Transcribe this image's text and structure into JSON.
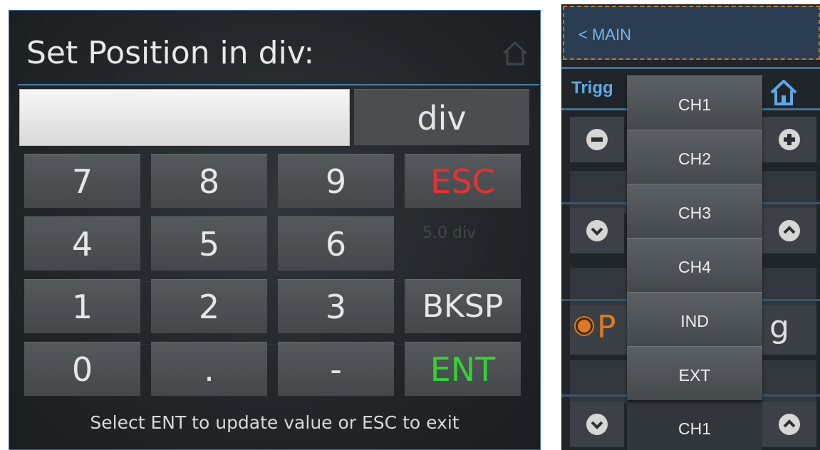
{
  "keypad": {
    "title": "Set Position in div:",
    "input_value": "",
    "unit": "div",
    "keys": [
      {
        "label": "7"
      },
      {
        "label": "8"
      },
      {
        "label": "9"
      },
      {
        "label": "ESC"
      },
      {
        "label": "4"
      },
      {
        "label": "5"
      },
      {
        "label": "6"
      },
      {
        "label": "1"
      },
      {
        "label": "2"
      },
      {
        "label": "3"
      },
      {
        "label": "BKSP"
      },
      {
        "label": "0"
      },
      {
        "label": "."
      },
      {
        "label": "-"
      },
      {
        "label": "ENT"
      }
    ],
    "hint": "Select ENT to update value or ESC to exit",
    "background_text": {
      "position_value": "5.0 div"
    },
    "colors": {
      "esc": "#e53232",
      "ent": "#35d235",
      "accent": "#4a7ea8"
    }
  },
  "trigger_menu": {
    "back_label": "< MAIN",
    "section_label": "Trigg",
    "edge_left_fragment": "P",
    "edge_right_fragment": "g",
    "dropdown_options": [
      "CH1",
      "CH2",
      "CH3",
      "CH4",
      "IND",
      "EXT"
    ],
    "current_source": "CH1",
    "icons": [
      "home-icon",
      "minus-icon",
      "plus-icon",
      "chevron-down-icon",
      "chevron-up-icon",
      "radio-selected-icon"
    ],
    "colors": {
      "label": "#5fa8e8",
      "edge": "#e07a20",
      "frame": "#b07a3a"
    }
  }
}
